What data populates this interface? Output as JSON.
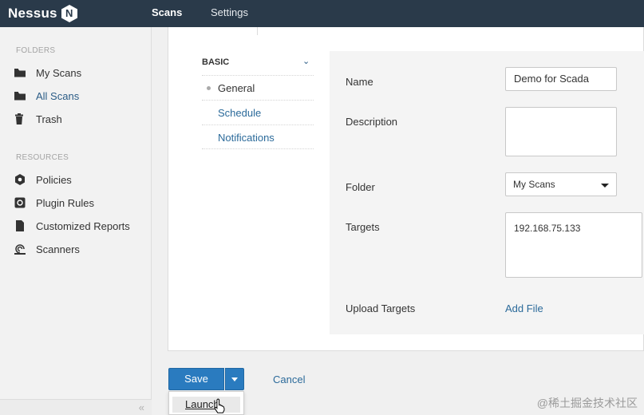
{
  "app": {
    "logo_text": "Nessus",
    "logo_badge": "N"
  },
  "nav": {
    "scans": "Scans",
    "settings": "Settings"
  },
  "sidebar": {
    "folders_heading": "FOLDERS",
    "folders": [
      {
        "label": "My Scans",
        "icon": "folder-icon"
      },
      {
        "label": "All Scans",
        "icon": "folder-icon"
      },
      {
        "label": "Trash",
        "icon": "trash-icon"
      }
    ],
    "resources_heading": "RESOURCES",
    "resources": [
      {
        "label": "Policies",
        "icon": "shield-icon"
      },
      {
        "label": "Plugin Rules",
        "icon": "plugin-rules-icon"
      },
      {
        "label": "Customized Reports",
        "icon": "report-icon"
      },
      {
        "label": "Scanners",
        "icon": "scanner-icon"
      }
    ],
    "collapse_glyph": "«"
  },
  "settings_nav": {
    "heading": "BASIC",
    "items": [
      "General",
      "Schedule",
      "Notifications"
    ]
  },
  "form": {
    "name_label": "Name",
    "name_value": "Demo for Scada",
    "description_label": "Description",
    "description_value": "",
    "folder_label": "Folder",
    "folder_value": "My Scans",
    "targets_label": "Targets",
    "targets_value": "192.168.75.133",
    "upload_label": "Upload Targets",
    "upload_link": "Add File"
  },
  "actions": {
    "save": "Save",
    "cancel": "Cancel",
    "launch": "Launch"
  },
  "watermark": "@稀土掘金技术社区",
  "colors": {
    "topbar": "#2a3a4a",
    "primary": "#2a7bbf",
    "link": "#2b6a9a"
  }
}
